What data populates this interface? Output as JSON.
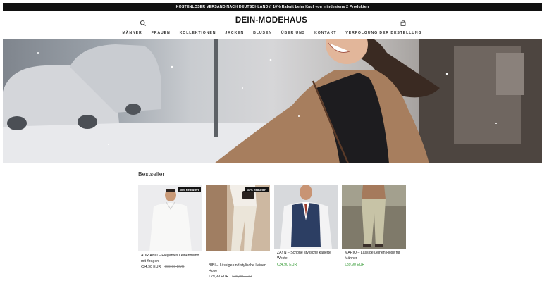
{
  "announcement": {
    "text": "KOSTENLOSER VERSAND NACH DEUTSCHLAND // 10% Rabatt beim Kauf von mindestens 2 Produkten"
  },
  "header": {
    "logo": "DEIN-MODEHAUS",
    "nav": [
      {
        "label": "MÄNNER"
      },
      {
        "label": "FRAUEN"
      },
      {
        "label": "KOLLEKTIONEN"
      },
      {
        "label": "JACKEN"
      },
      {
        "label": "BLUSEN"
      },
      {
        "label": "ÜBER UNS"
      },
      {
        "label": "KONTAKT"
      },
      {
        "label": "VERFOLGUNG DER BESTELLUNG"
      }
    ],
    "icons": {
      "search": "search-icon",
      "cart": "cart-icon"
    }
  },
  "bestseller": {
    "title": "Bestseller",
    "products": [
      {
        "name": "ADRIANO – Elegantes Leinenhemd mit Kragen",
        "price": "€34,90 EUR",
        "old_price": "€59,99 EUR",
        "badge": "30% Reduziert"
      },
      {
        "name": "BIBI – Lässige und stylische Leinen Hose",
        "price": "€29,99 EUR",
        "old_price": "€46,99 EUR",
        "badge": "33% Reduziert"
      },
      {
        "name": "ZAYN – Schöne stylische karierte Weste",
        "price": "€34,90 EUR",
        "old_price": "",
        "badge": ""
      },
      {
        "name": "MARIO – Lässige Leinen Hose für Männer",
        "price": "€39,90 EUR",
        "old_price": "",
        "badge": ""
      }
    ]
  },
  "colors": {
    "announcement_bg": "#111111",
    "sale_price": "#3a9d3a",
    "badge_bg": "#121212"
  }
}
